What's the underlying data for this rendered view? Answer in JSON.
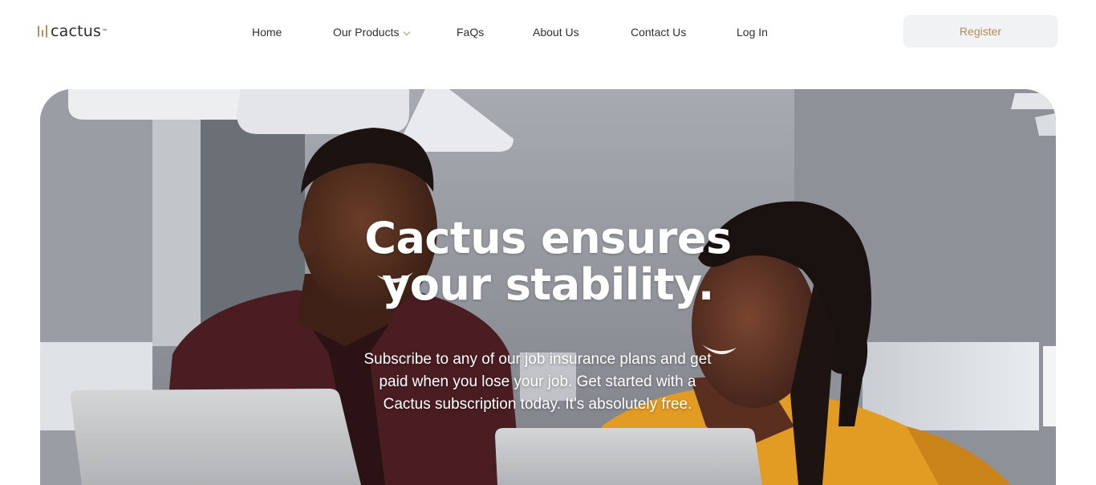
{
  "brand": {
    "name": "cactus",
    "mark": "™"
  },
  "nav": {
    "items": [
      {
        "label": "Home",
        "has_dropdown": false
      },
      {
        "label": "Our Products",
        "has_dropdown": true
      },
      {
        "label": "FaQs",
        "has_dropdown": false
      },
      {
        "label": "About Us",
        "has_dropdown": false
      },
      {
        "label": "Contact Us",
        "has_dropdown": false
      },
      {
        "label": "Log In",
        "has_dropdown": false
      }
    ],
    "register_label": "Register"
  },
  "hero": {
    "title_line1": "Cactus ensures",
    "title_line2": "your stability.",
    "subtitle": "Subscribe to any of our job insurance plans and get paid when you lose your job. Get started with a Cactus subscription today. It’s absolutely free."
  },
  "colors": {
    "accent": "#b9915e",
    "register_bg": "#f1f2f4",
    "register_text": "#b58a5a",
    "nav_text": "#2f2f2f"
  }
}
